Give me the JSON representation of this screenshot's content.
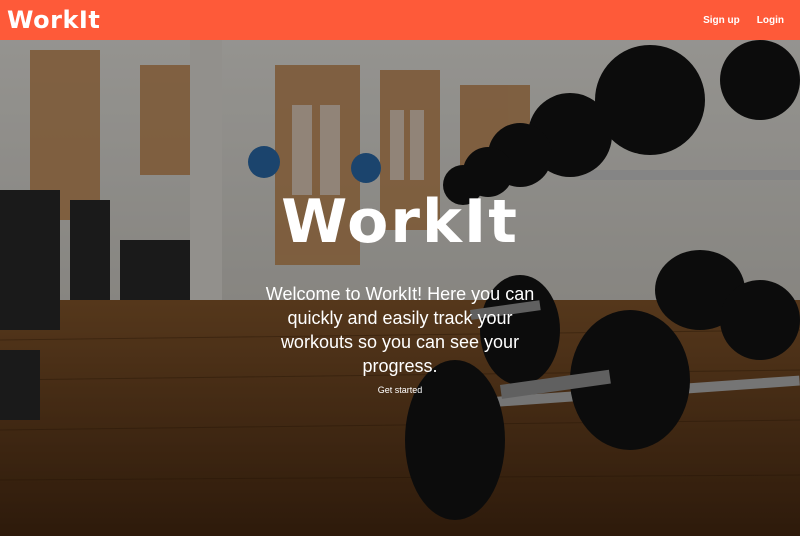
{
  "nav": {
    "brand": "WorkIt",
    "links": [
      {
        "label": "Sign up"
      },
      {
        "label": "Login"
      }
    ]
  },
  "hero": {
    "title": "WorkIt",
    "text": "Welcome to WorkIt! Here you can quickly and easily track your workouts so you can see your progress.",
    "cta": "Get started"
  },
  "colors": {
    "navbar": "#fe5a39",
    "text": "#ffffff"
  }
}
